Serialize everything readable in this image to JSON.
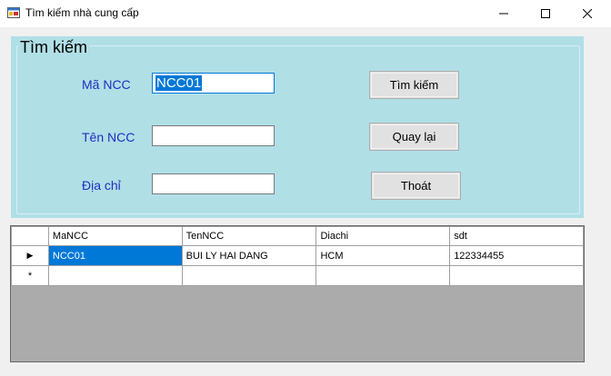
{
  "window": {
    "title": "Tìm kiếm nhà cung cấp"
  },
  "search_group": {
    "title": "Tìm kiếm",
    "ma_ncc_label": "Mã NCC",
    "ma_ncc_value": "NCC01",
    "ten_ncc_label": "Tên NCC",
    "ten_ncc_value": "",
    "dia_chi_label": "Địa chỉ",
    "dia_chi_value": "",
    "search_button": "Tìm kiếm",
    "back_button": "Quay lại",
    "exit_button": "Thoát"
  },
  "grid": {
    "columns": [
      "MaNCC",
      "TenNCC",
      "Diachi",
      "sdt"
    ],
    "rows": [
      {
        "indicator": "▶",
        "cells": [
          "NCC01",
          "BUI LY HAI DANG",
          "HCM",
          "122334455"
        ]
      },
      {
        "indicator": "*",
        "cells": [
          "",
          "",
          "",
          ""
        ]
      }
    ]
  },
  "colors": {
    "group_background": "#b0dfe6",
    "label_text": "#1f2fbf",
    "selection": "#0078d7"
  }
}
